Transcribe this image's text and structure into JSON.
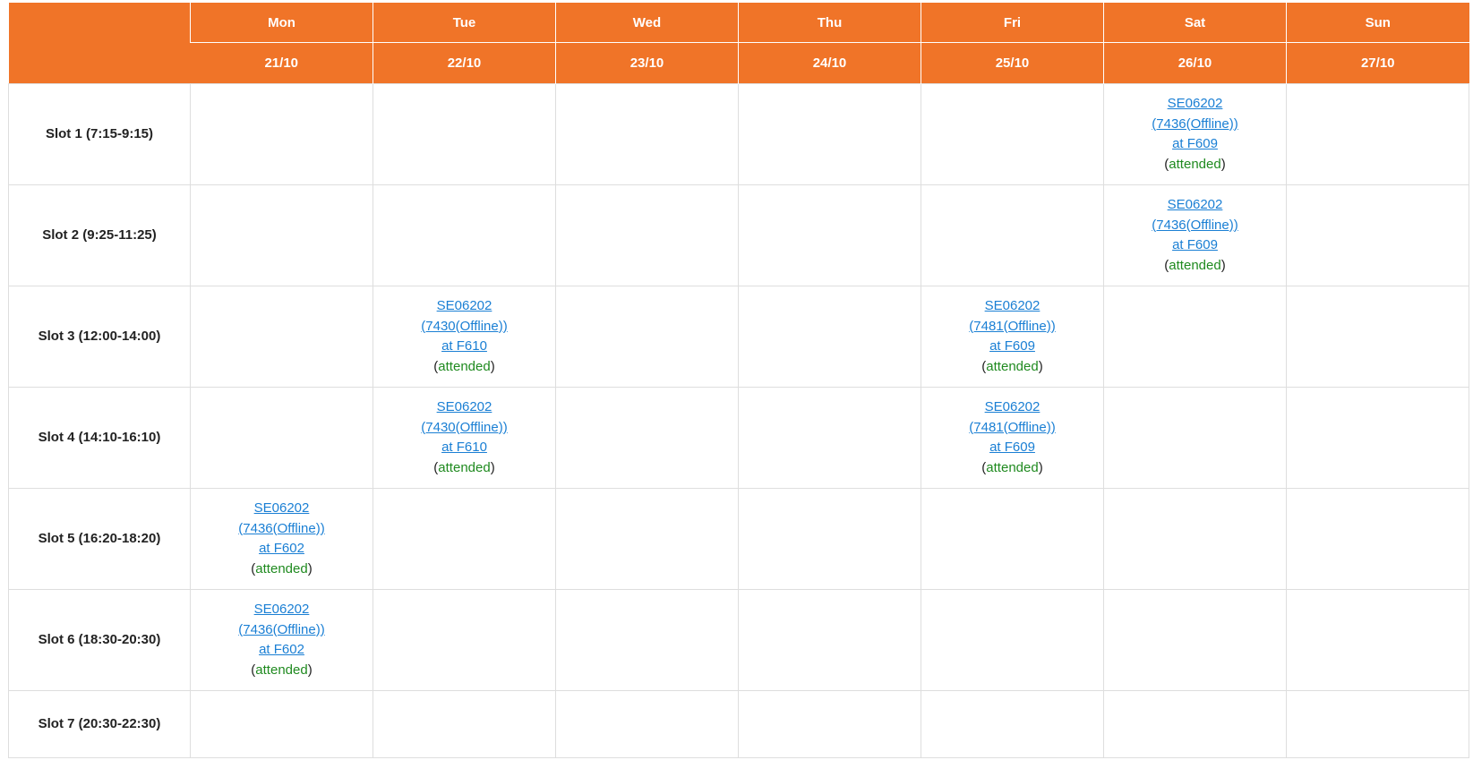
{
  "colors": {
    "header_bg": "#f07428",
    "header_text": "#ffffff",
    "link": "#1a7fd4",
    "attended": "#1f8a1f",
    "grid_line": "#dedede"
  },
  "days": [
    {
      "name": "Mon",
      "date": "21/10"
    },
    {
      "name": "Tue",
      "date": "22/10"
    },
    {
      "name": "Wed",
      "date": "23/10"
    },
    {
      "name": "Thu",
      "date": "24/10"
    },
    {
      "name": "Fri",
      "date": "25/10"
    },
    {
      "name": "Sat",
      "date": "26/10"
    },
    {
      "name": "Sun",
      "date": "27/10"
    }
  ],
  "slots": [
    {
      "label": "Slot 1 (7:15-9:15)",
      "cells": [
        null,
        null,
        null,
        null,
        null,
        {
          "course": "SE06202",
          "class": "(7436(Offline))",
          "room": "at F609",
          "status": "attended"
        },
        null
      ]
    },
    {
      "label": "Slot 2 (9:25-11:25)",
      "cells": [
        null,
        null,
        null,
        null,
        null,
        {
          "course": "SE06202",
          "class": "(7436(Offline))",
          "room": "at F609",
          "status": "attended"
        },
        null
      ]
    },
    {
      "label": "Slot 3 (12:00-14:00)",
      "cells": [
        null,
        {
          "course": "SE06202",
          "class": "(7430(Offline))",
          "room": "at F610",
          "status": "attended"
        },
        null,
        null,
        {
          "course": "SE06202",
          "class": "(7481(Offline))",
          "room": "at F609",
          "status": "attended"
        },
        null,
        null
      ]
    },
    {
      "label": "Slot 4 (14:10-16:10)",
      "cells": [
        null,
        {
          "course": "SE06202",
          "class": "(7430(Offline))",
          "room": "at F610",
          "status": "attended"
        },
        null,
        null,
        {
          "course": "SE06202",
          "class": "(7481(Offline))",
          "room": "at F609",
          "status": "attended"
        },
        null,
        null
      ]
    },
    {
      "label": "Slot 5 (16:20-18:20)",
      "cells": [
        {
          "course": "SE06202",
          "class": "(7436(Offline))",
          "room": "at F602",
          "status": "attended"
        },
        null,
        null,
        null,
        null,
        null,
        null
      ]
    },
    {
      "label": "Slot 6 (18:30-20:30)",
      "cells": [
        {
          "course": "SE06202",
          "class": "(7436(Offline))",
          "room": "at F602",
          "status": "attended"
        },
        null,
        null,
        null,
        null,
        null,
        null
      ]
    },
    {
      "label": "Slot 7 (20:30-22:30)",
      "cells": [
        null,
        null,
        null,
        null,
        null,
        null,
        null
      ]
    }
  ]
}
